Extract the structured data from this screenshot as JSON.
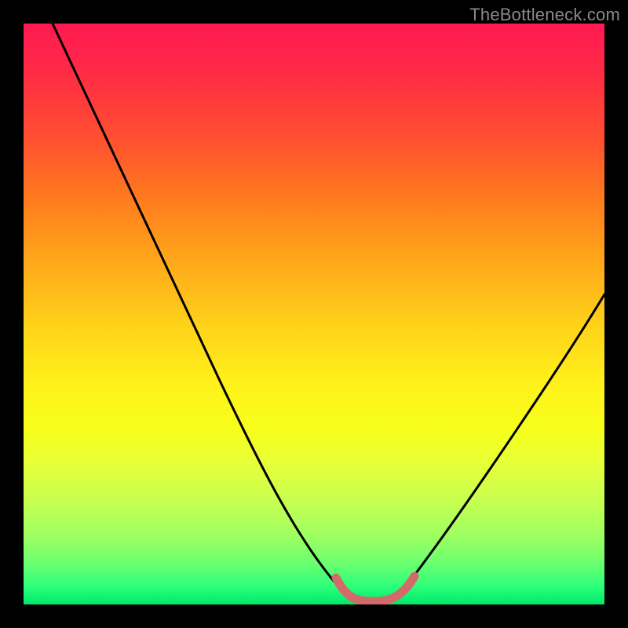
{
  "watermark": "TheBottleneck.com",
  "chart_data": {
    "type": "line",
    "title": "",
    "xlabel": "",
    "ylabel": "",
    "xlim": [
      0,
      100
    ],
    "ylim": [
      0,
      100
    ],
    "grid": false,
    "legend": false,
    "notes": "No axis tick labels or numeric values are rendered in the image; curve values are estimates of relative height (0=bottom, 100=top) at relative x positions (0=left, 100=right). Background is a vertical hue gradient from red (top) through yellow to green (bottom).",
    "series": [
      {
        "name": "bottleneck-curve",
        "color": "#000000",
        "x": [
          5,
          10,
          15,
          20,
          25,
          30,
          35,
          40,
          45,
          50,
          53,
          55,
          57,
          60,
          63,
          65,
          70,
          75,
          80,
          85,
          90,
          95,
          100
        ],
        "values": [
          100,
          92,
          83,
          74,
          65,
          56,
          47,
          38,
          29,
          20,
          13,
          8,
          4,
          2,
          2,
          3,
          7,
          14,
          22,
          31,
          40,
          49,
          57
        ]
      },
      {
        "name": "valley-marker",
        "color": "#d36a6a",
        "x": [
          54,
          56,
          58,
          60,
          62,
          64,
          66
        ],
        "values": [
          6,
          3,
          2,
          2,
          2,
          3,
          5
        ]
      }
    ],
    "background_gradient_stops": [
      {
        "pos": 0,
        "color": "#ff1a52"
      },
      {
        "pos": 20,
        "color": "#ff5030"
      },
      {
        "pos": 40,
        "color": "#ffa41a"
      },
      {
        "pos": 62,
        "color": "#fff11a"
      },
      {
        "pos": 82,
        "color": "#c8ff50"
      },
      {
        "pos": 100,
        "color": "#00e86a"
      }
    ]
  }
}
